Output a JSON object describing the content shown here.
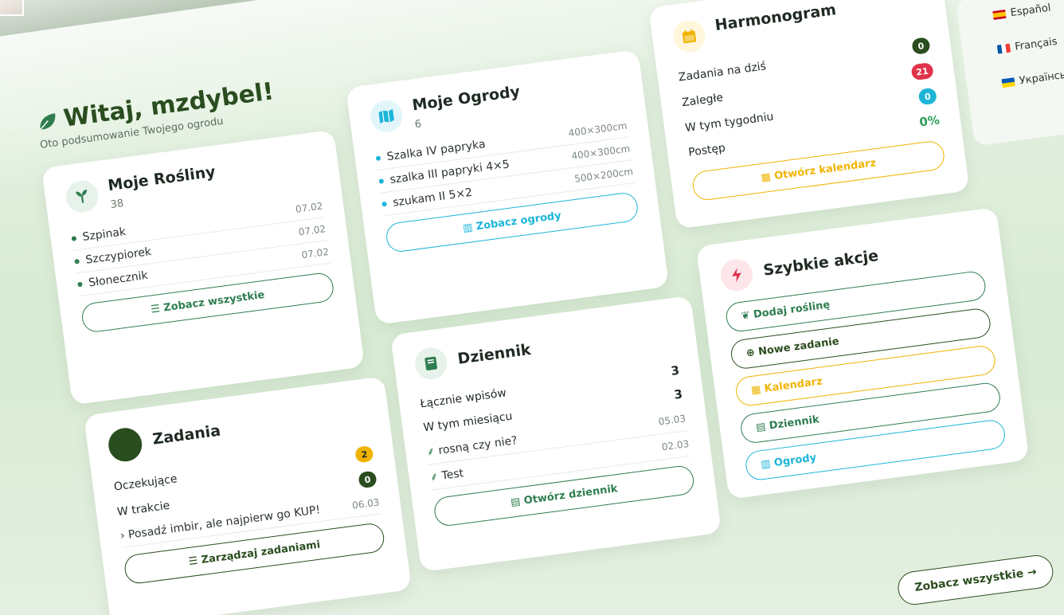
{
  "greeting": {
    "title": "Witaj, mzdybel!",
    "subtitle": "Oto podsumowanie Twojego ogrodu"
  },
  "plants": {
    "title": "Moje Rośliny",
    "count": "38",
    "items": [
      {
        "name": "Szpinak",
        "date": "07.02"
      },
      {
        "name": "Szczypiorek",
        "date": "07.02"
      },
      {
        "name": "Słonecznik",
        "date": "07.02"
      }
    ],
    "button": "Zobacz wszystkie"
  },
  "gardens": {
    "title": "Moje Ogrody",
    "count": "6",
    "items": [
      {
        "name": "Szalka IV papryka",
        "size": "400×300cm"
      },
      {
        "name": "szalka III papryki 4×5",
        "size": "400×300cm"
      },
      {
        "name": "szukam II 5×2",
        "size": "500×200cm"
      }
    ],
    "button": "Zobacz ogrody"
  },
  "schedule": {
    "title": "Harmonogram",
    "rows": [
      {
        "label": "Zadania na dziś",
        "value": "0"
      },
      {
        "label": "Zaległe",
        "value": "21"
      },
      {
        "label": "W tym tygodniu",
        "value": "0"
      },
      {
        "label": "Postęp",
        "value": "0%"
      }
    ],
    "button": "Otwórz kalendarz"
  },
  "tasks": {
    "title": "Zadania",
    "rows": [
      {
        "label": "Oczekujące",
        "value": "2"
      },
      {
        "label": "W trakcie",
        "value": "0"
      }
    ],
    "items": [
      {
        "name": "Posadź imbir, ale najpierw go KUP!",
        "date": "06.03"
      }
    ],
    "button": "Zarządzaj zadaniami"
  },
  "journal": {
    "title": "Dziennik",
    "rows": [
      {
        "label": "Łącznie wpisów",
        "value": "3"
      },
      {
        "label": "W tym miesiącu",
        "value": "3"
      }
    ],
    "items": [
      {
        "name": "rosną czy nie?",
        "date": "05.03"
      },
      {
        "name": "Test",
        "date": "02.03"
      }
    ],
    "button": "Otwórz dziennik"
  },
  "quick": {
    "title": "Szybkie akcje",
    "actions": [
      {
        "label": "Dodaj roślinę"
      },
      {
        "label": "Nowe zadanie"
      },
      {
        "label": "Kalendarz"
      },
      {
        "label": "Dziennik"
      },
      {
        "label": "Ogrody"
      }
    ]
  },
  "languages": [
    {
      "label": "Español"
    },
    {
      "label": "Français"
    },
    {
      "label": "Українськ"
    }
  ],
  "see_all": "Zobacz wszystkie →",
  "colors": {
    "primary": "#2a4d1f",
    "accent_green": "#2e7d4f",
    "accent_cyan": "#1cb5d8",
    "accent_yellow": "#f0b400",
    "accent_red": "#e0334a"
  }
}
